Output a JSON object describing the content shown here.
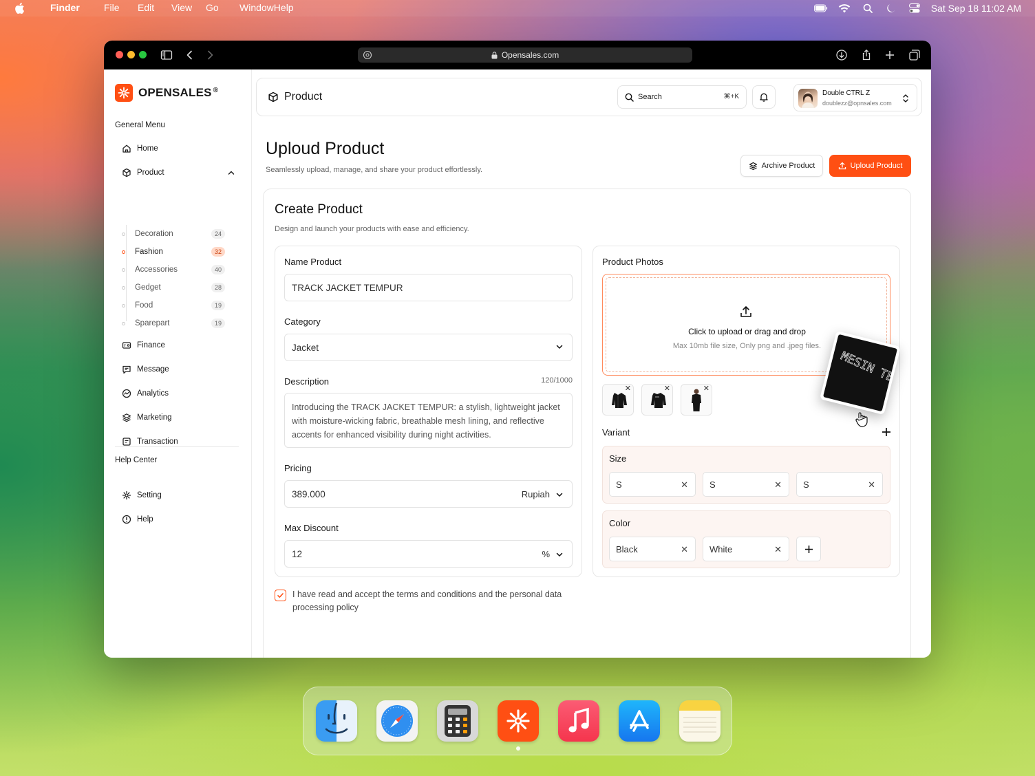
{
  "menubar": {
    "app": "Finder",
    "items": [
      "File",
      "Edit",
      "View",
      "Go",
      "WindowHelp"
    ],
    "datetime": "Sat Sep 18  11:02 AM"
  },
  "browser": {
    "url": "Opensales.com"
  },
  "brand": {
    "name": "OPENSALES",
    "mark": "®",
    "accent": "#ff4f13"
  },
  "sidebar": {
    "general_heading": "General Menu",
    "home": "Home",
    "product": "Product",
    "subitems": [
      {
        "label": "Decoration",
        "count": "24"
      },
      {
        "label": "Fashion",
        "count": "32"
      },
      {
        "label": "Accessories",
        "count": "40"
      },
      {
        "label": "Gedget",
        "count": "28"
      },
      {
        "label": "Food",
        "count": "19"
      },
      {
        "label": "Sparepart",
        "count": "19"
      }
    ],
    "finance": "Finance",
    "message": "Message",
    "analytics": "Analytics",
    "marketing": "Marketing",
    "transaction": "Transaction",
    "help_heading": "Help Center",
    "setting": "Setting",
    "help": "Help"
  },
  "topbar": {
    "title": "Product",
    "search_label": "Search",
    "search_shortcut": "⌘+K",
    "user_name": "Double CTRL  Z",
    "user_email": "doublezz@opnsales.com"
  },
  "page": {
    "title": "Uploud Product",
    "subtitle": "Seamlessly upload, manage, and share your product effortlessly.",
    "archive_button": "Archive Product",
    "upload_button": "Uploud Product"
  },
  "form": {
    "title": "Create Product",
    "subtitle": "Design and launch your products with ease and efficiency.",
    "name_label": "Name Product",
    "name_value": "TRACK JACKET TEMPUR",
    "category_label": "Category",
    "category_value": "Jacket",
    "description_label": "Description",
    "description_counter": "120/1000",
    "description_value": "Introducing the TRACK JACKET TEMPUR: a stylish, lightweight jacket with moisture-wicking fabric, breathable mesh lining, and reflective accents for enhanced visibility during night activities.",
    "pricing_label": "Pricing",
    "pricing_value": "389.000",
    "currency": "Rupiah",
    "discount_label": "Max Discount",
    "discount_value": "12",
    "discount_unit": "%",
    "terms": "I have read and accept the terms and conditions and the personal data processing policy",
    "terms_checked": true
  },
  "photos": {
    "label": "Product Photos",
    "upload_main": "Click to upload or drag and drop",
    "upload_sub": "Max 10mb file size, Only png and .jpeg files.",
    "dragged_image_text": "MESIN TEMPUR",
    "thumbnails": [
      "jacket-front",
      "jacket-back",
      "model-wearing-jacket"
    ]
  },
  "variant": {
    "label": "Variant",
    "size_label": "Size",
    "sizes": [
      "S",
      "S",
      "S"
    ],
    "color_label": "Color",
    "colors": [
      "Black",
      "White"
    ]
  },
  "dock": {
    "apps": [
      "finder-icon",
      "safari-icon",
      "calculator-icon",
      "opensales-icon",
      "music-icon",
      "app-store-icon",
      "notes-icon"
    ]
  }
}
